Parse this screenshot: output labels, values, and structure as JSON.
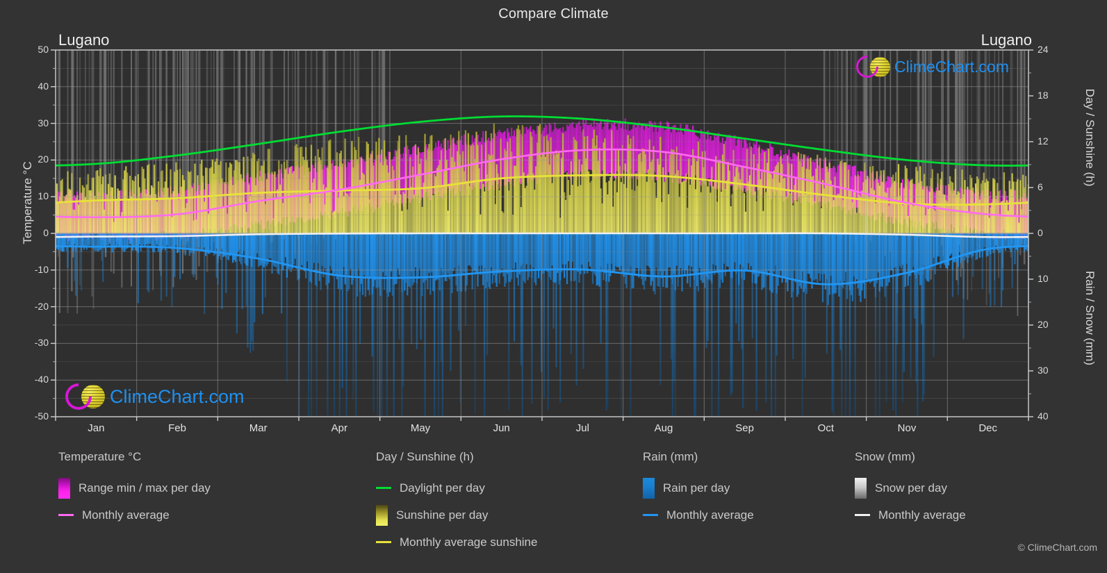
{
  "header": {
    "title": "Compare Climate",
    "location_left": "Lugano",
    "location_right": "Lugano"
  },
  "branding": {
    "logo_text": "ClimeChart.com",
    "copyright": "© ClimeChart.com"
  },
  "axes": {
    "left_title": "Temperature °C",
    "right_title_upper": "Day / Sunshine (h)",
    "right_title_lower": "Rain / Snow (mm)",
    "left_ticks": [
      "50",
      "40",
      "30",
      "20",
      "10",
      "0",
      "-10",
      "-20",
      "-30",
      "-40",
      "-50"
    ],
    "right_ticks_upper": [
      "24",
      "18",
      "12",
      "6",
      "0"
    ],
    "right_ticks_lower": [
      "10",
      "20",
      "30",
      "40"
    ],
    "months": [
      "Jan",
      "Feb",
      "Mar",
      "Apr",
      "May",
      "Jun",
      "Jul",
      "Aug",
      "Sep",
      "Oct",
      "Nov",
      "Dec"
    ]
  },
  "legend": {
    "columns": [
      {
        "heading": "Temperature °C",
        "items": [
          {
            "label": "Range min / max per day",
            "marker": "swatch",
            "swatch_class": "sw-temp",
            "color": "#ff22ee"
          },
          {
            "label": "Monthly average",
            "marker": "line",
            "color": "#ff6bf0"
          }
        ]
      },
      {
        "heading": "Day / Sunshine (h)",
        "items": [
          {
            "label": "Daylight per day",
            "marker": "line",
            "color": "#00dd33"
          },
          {
            "label": "Sunshine per day",
            "marker": "swatch",
            "swatch_class": "sw-sun",
            "color": "#e6e452"
          },
          {
            "label": "Monthly average sunshine",
            "marker": "line",
            "color": "#e8e23a"
          }
        ]
      },
      {
        "heading": "Rain (mm)",
        "items": [
          {
            "label": "Rain per day",
            "marker": "swatch",
            "swatch_class": "sw-rain",
            "color": "#1b8bdc"
          },
          {
            "label": "Monthly average",
            "marker": "line",
            "color": "#2196f3"
          }
        ]
      },
      {
        "heading": "Snow (mm)",
        "items": [
          {
            "label": "Snow per day",
            "marker": "swatch",
            "swatch_class": "sw-snow",
            "color": "#e6e6e6"
          },
          {
            "label": "Monthly average",
            "marker": "line",
            "color": "#f0f0f0"
          }
        ]
      }
    ]
  },
  "colors": {
    "background": "#333333",
    "grid": "#8c8c8c",
    "text": "#d9d9d9",
    "daylight": "#00dd33",
    "sunshine_avg": "#e8e23a",
    "temp_avg": "#ff6bf0",
    "rain_avg": "#2196f3",
    "snow_avg": "#f0f0f0",
    "temp_band": "#ff22ee",
    "sunshine_band": "#cfc945",
    "rain_band": "#1b7fd0",
    "snow_band": "#bdbdbd",
    "logo_magenta": "#d717d7",
    "logo_yellow": "#ddd02e",
    "logo_blue": "#1e90f0"
  },
  "chart_data": {
    "type": "line",
    "title": "Compare Climate",
    "subtitle": "Lugano",
    "xlabel": "",
    "ylabel": "Temperature °C",
    "y2label_upper": "Day / Sunshine (h)",
    "y2label_lower": "Rain / Snow (mm)",
    "grid": true,
    "legend_position": "below",
    "ylim": [
      -50,
      50
    ],
    "y2lim_upper": [
      0,
      24
    ],
    "y2lim_lower": [
      0,
      40
    ],
    "categories": [
      "Jan",
      "Feb",
      "Mar",
      "Apr",
      "May",
      "Jun",
      "Jul",
      "Aug",
      "Sep",
      "Oct",
      "Nov",
      "Dec"
    ],
    "series": [
      {
        "name": "Daylight per day",
        "unit": "h",
        "axis": "right_upper",
        "color": "#00dd33",
        "values": [
          9.1,
          10.2,
          11.7,
          13.3,
          14.6,
          15.3,
          15.0,
          13.9,
          12.4,
          10.9,
          9.6,
          8.9
        ]
      },
      {
        "name": "Monthly average sunshine",
        "unit": "h",
        "axis": "right_upper",
        "color": "#e8e23a",
        "values": [
          4.3,
          4.6,
          5.3,
          5.6,
          5.9,
          7.2,
          7.6,
          7.5,
          6.4,
          5.0,
          3.9,
          3.8
        ]
      },
      {
        "name": "Monthly average temperature",
        "unit": "°C",
        "axis": "left",
        "color": "#ff6bf0",
        "values": [
          4.4,
          5.2,
          8.8,
          11.9,
          16.0,
          20.2,
          22.7,
          22.2,
          18.1,
          13.4,
          8.3,
          5.2
        ]
      },
      {
        "name": "Rain monthly average",
        "unit": "mm",
        "axis": "right_lower",
        "color": "#2196f3",
        "values": [
          2.9,
          3.2,
          5.5,
          9.2,
          9.6,
          8.3,
          7.9,
          9.4,
          8.1,
          11.1,
          8.6,
          3.4
        ]
      },
      {
        "name": "Snow monthly average",
        "unit": "mm",
        "axis": "right_lower",
        "color": "#f0f0f0",
        "values": [
          0.7,
          0.6,
          0.2,
          0.05,
          0.0,
          0.0,
          0.0,
          0.0,
          0.0,
          0.0,
          0.3,
          0.8
        ]
      }
    ],
    "bands": [
      {
        "name": "Range min / max per day",
        "unit": "°C",
        "axis": "left",
        "color": "#ff22ee",
        "min": [
          -1.0,
          -0.5,
          2.0,
          5.5,
          9.5,
          13.5,
          16.0,
          15.5,
          12.0,
          8.0,
          3.0,
          0.0
        ],
        "max": [
          9.5,
          11.0,
          15.0,
          18.5,
          22.5,
          26.5,
          29.0,
          28.5,
          24.0,
          18.5,
          13.0,
          10.0
        ]
      },
      {
        "name": "Sunshine per day",
        "unit": "h",
        "axis": "right_upper",
        "color": "#cfc945",
        "min": [
          0,
          0,
          0,
          0,
          0,
          0,
          0,
          0,
          0,
          0,
          0,
          0
        ],
        "max": [
          8.5,
          9.5,
          11.0,
          12.5,
          13.6,
          14.5,
          14.3,
          13.2,
          11.6,
          10.2,
          9.0,
          8.3
        ]
      },
      {
        "name": "Rain per day",
        "unit": "mm",
        "axis": "right_lower",
        "color": "#1b7fd0",
        "min": [
          0,
          0,
          0,
          0,
          0,
          0,
          0,
          0,
          0,
          0,
          0,
          0
        ],
        "max": [
          3.0,
          3.3,
          5.6,
          9.4,
          9.8,
          8.5,
          8.1,
          9.6,
          8.3,
          11.3,
          8.8,
          3.6
        ]
      }
    ]
  }
}
